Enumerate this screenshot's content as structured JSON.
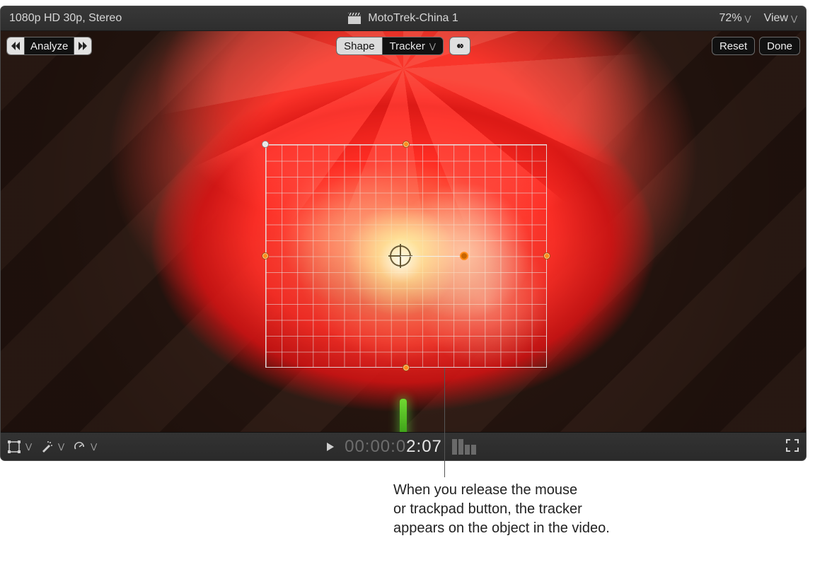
{
  "topbar": {
    "format_info": "1080p HD 30p, Stereo",
    "project_name": "MotoTrek-China 1",
    "zoom": "72%",
    "view_label": "View"
  },
  "osd": {
    "analyze_label": "Analyze",
    "shape_label": "Shape",
    "tracker_label": "Tracker",
    "reset_label": "Reset",
    "done_label": "Done"
  },
  "timecode": {
    "dim_part": "00:00:0",
    "bright_part": "2:07"
  },
  "callout": {
    "line1": "When you release the mouse",
    "line2": "or trackpad button, the tracker",
    "line3": "appears on the object in the video."
  }
}
